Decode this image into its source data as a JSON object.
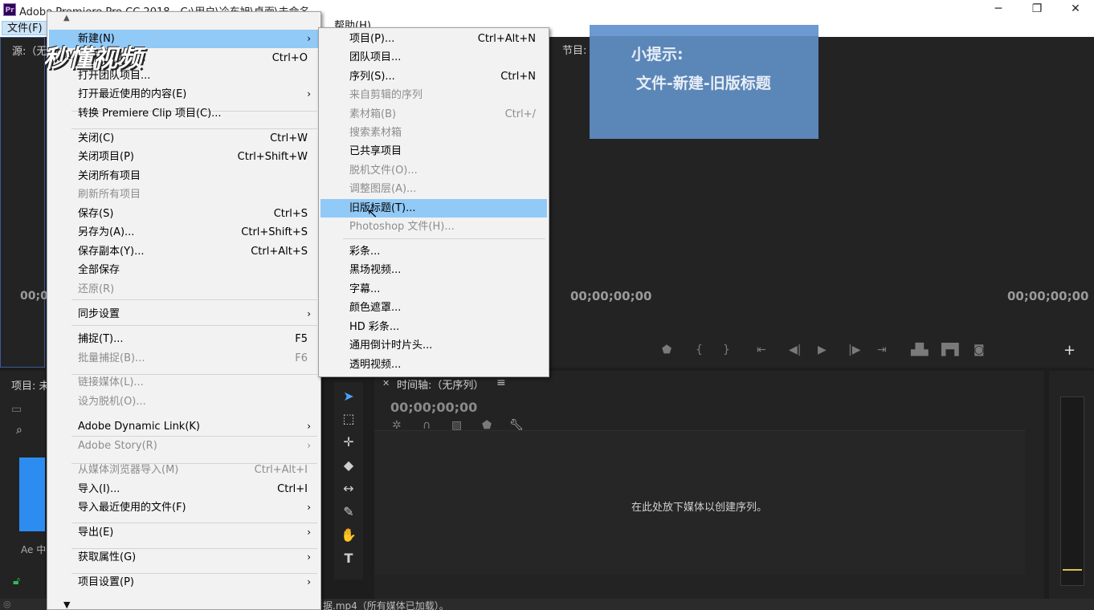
{
  "titlebar": {
    "logo": "Pr",
    "title": "Adobe Premiere Pro CC 2018 - C:\\用户\\冷东旭\\桌面\\未命名",
    "minimize": "─",
    "maximize": "❐",
    "close": "✕"
  },
  "menubar": {
    "file": "文件(F)",
    "help": "帮助(H)"
  },
  "source_panel": {
    "title": "源:（无",
    "timecode": "00;0"
  },
  "program_panel": {
    "title": "节目:（无序列",
    "timecode_left": "00;00;00;00",
    "timecode_right": "00;00;00;00"
  },
  "tip": {
    "title": "小提示:",
    "body": "文件-新建-旧版标题"
  },
  "project_panel": {
    "title": "项目: 未",
    "ae_label": "Ae 中"
  },
  "timeline": {
    "title": "时间轴:（无序列）",
    "timecode": "00;00;00;00",
    "drop_hint": "在此处放下媒体以创建序列。"
  },
  "status": {
    "text": "据.mp4（所有媒体已加载）。"
  },
  "watermark": "秒懂视频",
  "file_menu": {
    "items": [
      {
        "label": "新建(N)",
        "shortcut": "",
        "submenu": true,
        "disabled": false,
        "highlighted": true
      },
      {
        "label": "打开项目(O)...",
        "shortcut": "Ctrl+O",
        "submenu": false,
        "disabled": false
      },
      {
        "label": "打开团队项目...",
        "shortcut": "",
        "submenu": false,
        "disabled": false
      },
      {
        "label": "打开最近使用的内容(E)",
        "shortcut": "",
        "submenu": true,
        "disabled": false
      },
      {
        "label": "转换 Premiere Clip 项目(C)...",
        "shortcut": "",
        "submenu": false,
        "disabled": false
      },
      {
        "label": "关闭(C)",
        "shortcut": "Ctrl+W",
        "submenu": false,
        "disabled": false
      },
      {
        "label": "关闭项目(P)",
        "shortcut": "Ctrl+Shift+W",
        "submenu": false,
        "disabled": false
      },
      {
        "label": "关闭所有项目",
        "shortcut": "",
        "submenu": false,
        "disabled": false
      },
      {
        "label": "刷新所有项目",
        "shortcut": "",
        "submenu": false,
        "disabled": true
      },
      {
        "label": "保存(S)",
        "shortcut": "Ctrl+S",
        "submenu": false,
        "disabled": false
      },
      {
        "label": "另存为(A)...",
        "shortcut": "Ctrl+Shift+S",
        "submenu": false,
        "disabled": false
      },
      {
        "label": "保存副本(Y)...",
        "shortcut": "Ctrl+Alt+S",
        "submenu": false,
        "disabled": false
      },
      {
        "label": "全部保存",
        "shortcut": "",
        "submenu": false,
        "disabled": false
      },
      {
        "label": "还原(R)",
        "shortcut": "",
        "submenu": false,
        "disabled": true
      },
      {
        "label": "同步设置",
        "shortcut": "",
        "submenu": true,
        "disabled": false
      },
      {
        "label": "捕捉(T)...",
        "shortcut": "F5",
        "submenu": false,
        "disabled": false
      },
      {
        "label": "批量捕捉(B)...",
        "shortcut": "F6",
        "submenu": false,
        "disabled": true
      },
      {
        "label": "链接媒体(L)...",
        "shortcut": "",
        "submenu": false,
        "disabled": true
      },
      {
        "label": "设为脱机(O)...",
        "shortcut": "",
        "submenu": false,
        "disabled": true
      },
      {
        "label": "Adobe Dynamic Link(K)",
        "shortcut": "",
        "submenu": true,
        "disabled": false
      },
      {
        "label": "Adobe Story(R)",
        "shortcut": "",
        "submenu": true,
        "disabled": true
      },
      {
        "label": "从媒体浏览器导入(M)",
        "shortcut": "Ctrl+Alt+I",
        "submenu": false,
        "disabled": true
      },
      {
        "label": "导入(I)...",
        "shortcut": "Ctrl+I",
        "submenu": false,
        "disabled": false
      },
      {
        "label": "导入最近使用的文件(F)",
        "shortcut": "",
        "submenu": true,
        "disabled": false
      },
      {
        "label": "导出(E)",
        "shortcut": "",
        "submenu": true,
        "disabled": false
      },
      {
        "label": "获取属性(G)",
        "shortcut": "",
        "submenu": true,
        "disabled": false
      },
      {
        "label": "项目设置(P)",
        "shortcut": "",
        "submenu": true,
        "disabled": false
      }
    ]
  },
  "new_submenu": {
    "items": [
      {
        "label": "项目(P)...",
        "shortcut": "Ctrl+Alt+N",
        "disabled": false
      },
      {
        "label": "团队项目...",
        "shortcut": "",
        "disabled": false
      },
      {
        "label": "序列(S)...",
        "shortcut": "Ctrl+N",
        "disabled": false
      },
      {
        "label": "来自剪辑的序列",
        "shortcut": "",
        "disabled": true
      },
      {
        "label": "素材箱(B)",
        "shortcut": "Ctrl+/",
        "disabled": true
      },
      {
        "label": "搜索素材箱",
        "shortcut": "",
        "disabled": true
      },
      {
        "label": "已共享项目",
        "shortcut": "",
        "disabled": false
      },
      {
        "label": "脱机文件(O)...",
        "shortcut": "",
        "disabled": true
      },
      {
        "label": "调整图层(A)...",
        "shortcut": "",
        "disabled": true
      },
      {
        "label": "旧版标题(T)...",
        "shortcut": "",
        "disabled": false,
        "highlighted": true
      },
      {
        "label": "Photoshop 文件(H)...",
        "shortcut": "",
        "disabled": true
      },
      {
        "label": "彩条...",
        "shortcut": "",
        "disabled": false
      },
      {
        "label": "黑场视频...",
        "shortcut": "",
        "disabled": false
      },
      {
        "label": "字幕...",
        "shortcut": "",
        "disabled": false
      },
      {
        "label": "颜色遮罩...",
        "shortcut": "",
        "disabled": false
      },
      {
        "label": "HD 彩条...",
        "shortcut": "",
        "disabled": false
      },
      {
        "label": "通用倒计时片头...",
        "shortcut": "",
        "disabled": false
      },
      {
        "label": "透明视频...",
        "shortcut": "",
        "disabled": false
      }
    ]
  }
}
